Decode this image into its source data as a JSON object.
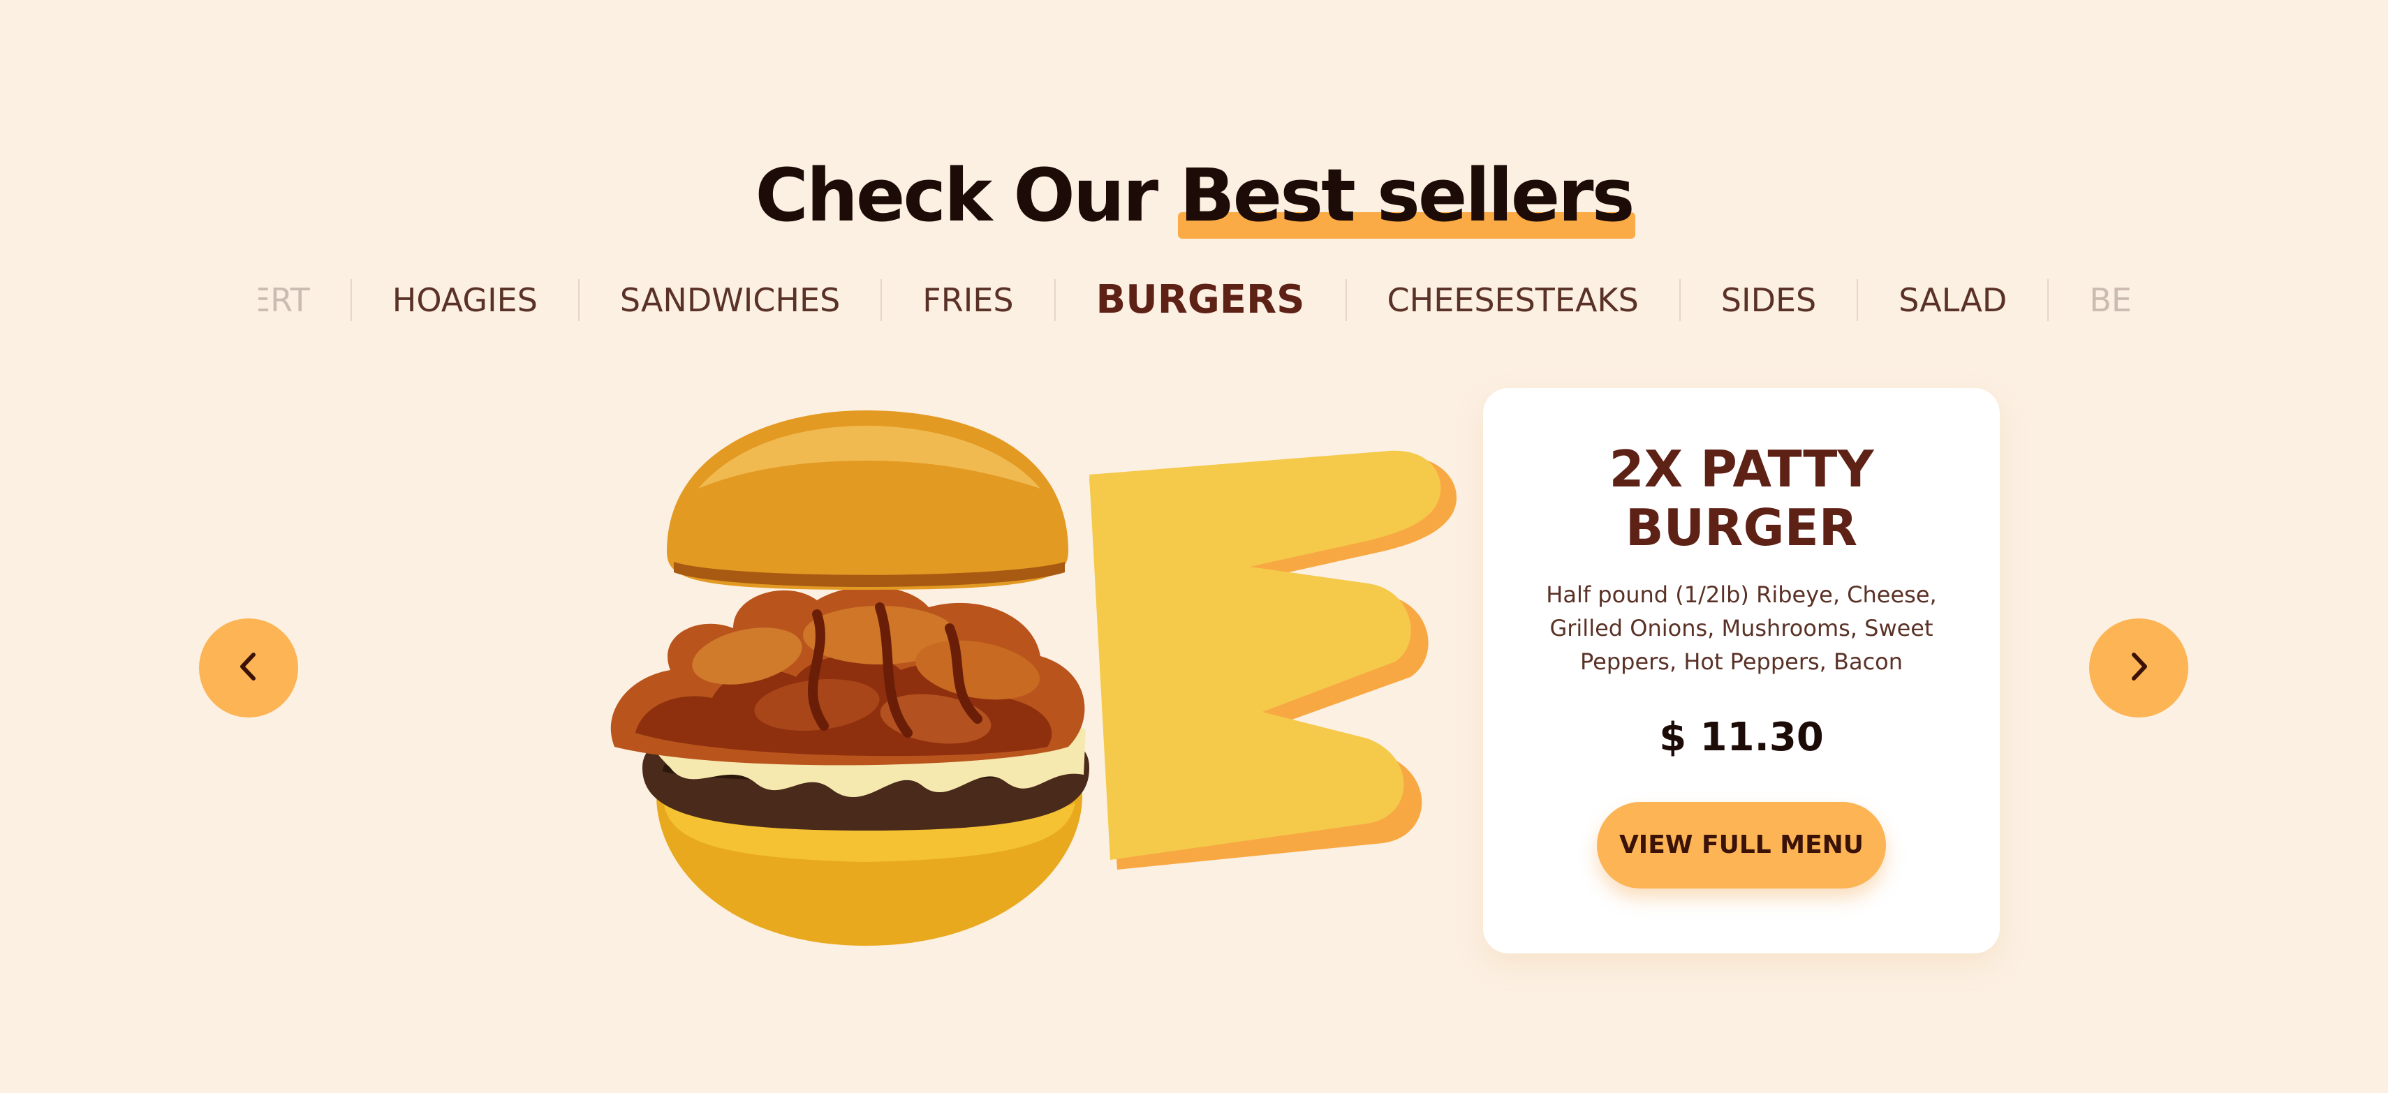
{
  "heading": {
    "prefix": "Check Our ",
    "highlight": "Best sellers"
  },
  "tabs": [
    {
      "label": "ERT",
      "state": "faded"
    },
    {
      "label": "HOAGIES",
      "state": "normal"
    },
    {
      "label": "SANDWICHES",
      "state": "normal"
    },
    {
      "label": "FRIES",
      "state": "normal"
    },
    {
      "label": "BURGERS",
      "state": "active"
    },
    {
      "label": "CHEESESTEAKS",
      "state": "normal"
    },
    {
      "label": "SIDES",
      "state": "normal"
    },
    {
      "label": "SALAD",
      "state": "normal"
    },
    {
      "label": "BEVE",
      "state": "faded"
    }
  ],
  "product": {
    "title_line1": "2X PATTY",
    "title_line2": "BURGER",
    "description": "Half pound (1/2lb) Ribeye, Cheese, Grilled Onions, Mushrooms, Sweet Peppers, Hot Peppers, Bacon",
    "price": "$ 11.30",
    "button_label": "VIEW FULL MENU",
    "image_icon": "burger-image"
  },
  "nav": {
    "prev_icon": "chevron-left-icon",
    "next_icon": "chevron-right-icon"
  },
  "colors": {
    "background": "#fcf0e3",
    "accent": "#fcb454",
    "highlight": "#fbab45",
    "swoosh": "#f5c94a",
    "title": "#5e2116",
    "text": "#5a3126"
  }
}
